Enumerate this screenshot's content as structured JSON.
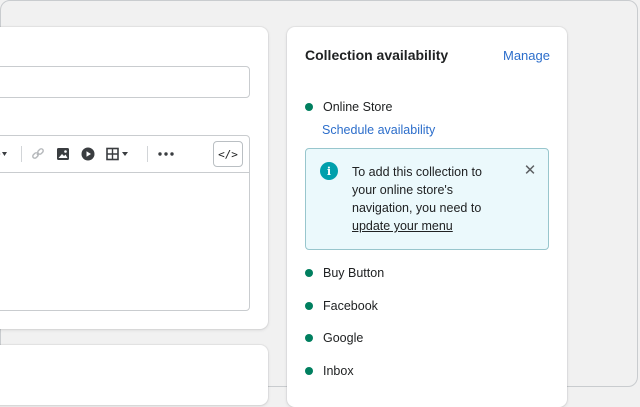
{
  "panel": {
    "title": "Collection availability",
    "manage_label": "Manage",
    "online_store": "Online Store",
    "schedule_label": "Schedule availability",
    "banner": {
      "text_before": "To add this collection to your online store's navigation, you need to ",
      "link": "update your menu",
      "info_icon": "i",
      "close_icon": "✕"
    },
    "channels": [
      "Buy Button",
      "Facebook",
      "Google",
      "Inbox"
    ]
  },
  "toolbar": {
    "code_label": "</>",
    "icons": [
      "chevron-down",
      "link",
      "image",
      "video",
      "table",
      "more"
    ]
  },
  "colors": {
    "accent_link": "#2c6ecb",
    "status_dot": "#007f5f",
    "banner_bg": "#ebf9fc",
    "info_icon": "#00a0ac"
  }
}
